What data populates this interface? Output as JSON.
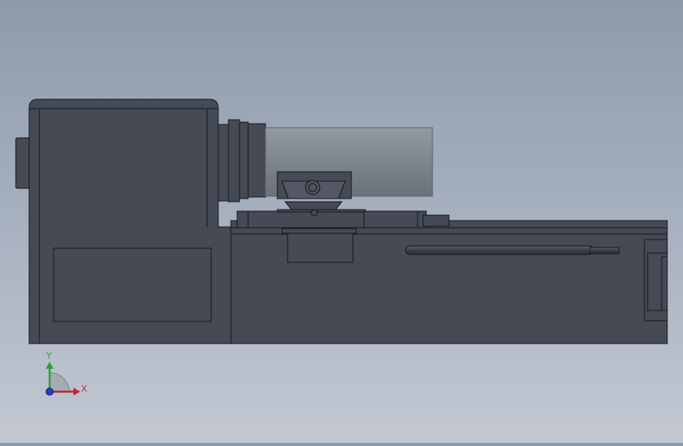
{
  "view": {
    "background_top": "#8e9aac",
    "background_bottom": "#c3c8d2",
    "model_fill": "#454a55",
    "model_edge": "#15171b",
    "shaft_fill": "#7e858f"
  },
  "triad": {
    "x_label": "X",
    "y_label": "Y",
    "x_color": "#c0282d",
    "y_color": "#28a23a",
    "z_color": "#2040c0"
  }
}
